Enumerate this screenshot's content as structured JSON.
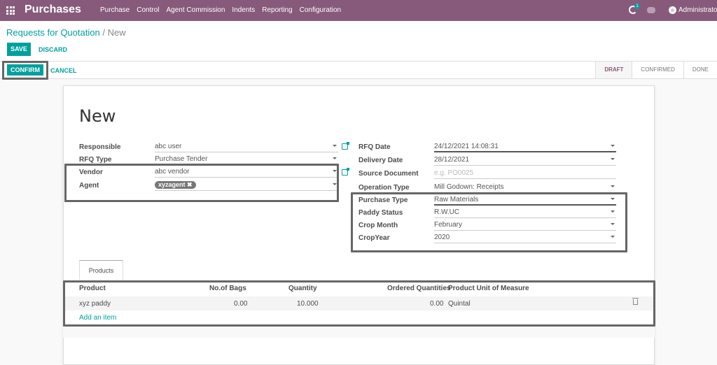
{
  "app": {
    "title": "Purchases",
    "icon": "apps-grid-icon"
  },
  "menu": [
    "Purchase",
    "Control",
    "Agent Commission",
    "Indents",
    "Reporting",
    "Configuration"
  ],
  "systray": {
    "activity_badge": "1",
    "user": "Administrato"
  },
  "breadcrumb": {
    "parent": "Requests for Quotation",
    "separator": "/",
    "current": "New"
  },
  "buttons": {
    "save": "SAVE",
    "discard": "DISCARD",
    "confirm": "CONFIRM",
    "cancel": "CANCEL"
  },
  "statusbar": {
    "steps": [
      "DRAFT",
      "CONFIRMED",
      "DONE"
    ],
    "active": "DRAFT"
  },
  "form": {
    "title": "New",
    "left": [
      {
        "label": "Responsible",
        "value": "abc user"
      },
      {
        "label": "RFQ Type",
        "value": "Purchase Tender"
      },
      {
        "label": "Vendor",
        "value": "abc vendor"
      },
      {
        "label": "Agent",
        "tag": "xyzagent"
      }
    ],
    "right": [
      {
        "label": "RFQ Date",
        "value": "24/12/2021 14:08:31"
      },
      {
        "label": "Delivery Date",
        "value": "28/12/2021"
      },
      {
        "label": "Source Document",
        "placeholder": "e.g. PO0025"
      },
      {
        "label": "Operation Type",
        "value": "Mill Godown: Receipts"
      },
      {
        "label": "Purchase Type",
        "value": "Raw Materials"
      },
      {
        "label": "Paddy Status",
        "value": "R.W.UC"
      },
      {
        "label": "Crop Month",
        "value": "February"
      },
      {
        "label": "CropYear",
        "value": "2020"
      }
    ]
  },
  "tabs": {
    "products": "Products"
  },
  "table": {
    "columns": [
      "Product",
      "No.of Bags",
      "Quantity",
      "Ordered Quantities",
      "Product Unit of Measure"
    ],
    "rows": [
      {
        "product": "xyz paddy",
        "bags": "0.00",
        "quantity": "10.000",
        "ordered": "0.00",
        "uom": "Quintal"
      }
    ],
    "add_item": "Add an item"
  },
  "colors": {
    "brand": "#875a7b",
    "accent": "#00a09d"
  }
}
